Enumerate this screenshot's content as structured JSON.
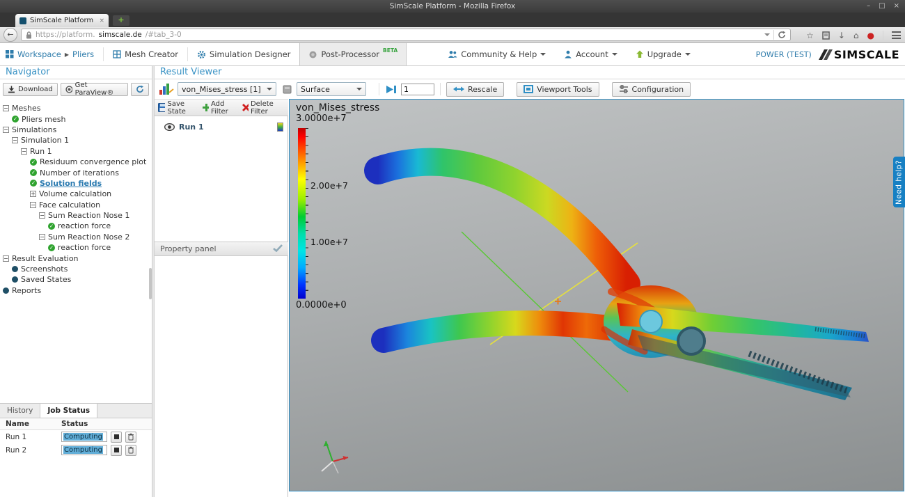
{
  "browser": {
    "window_title": "SimScale Platform - Mozilla Firefox",
    "window_controls": {
      "minimize": "–",
      "maximize": "□",
      "close": "×"
    },
    "tab": {
      "title": "SimScale Platform",
      "close": "×",
      "new_tab": "+"
    },
    "url": {
      "scheme_host": "https://platform.",
      "domain": "simscale.de",
      "path": "/#tab_3-0"
    },
    "icons": {
      "back": "←",
      "star": "☆",
      "downloads": "↓",
      "home": "⌂",
      "extension": "●"
    }
  },
  "app_nav": {
    "workspace": "Workspace",
    "breadcrumb_arrow": "▶",
    "project": "Pliers",
    "mesh_creator": "Mesh Creator",
    "simulation_designer": "Simulation Designer",
    "post_processor": "Post-Processor",
    "beta": "BETA",
    "community": "Community & Help",
    "account": "Account",
    "upgrade": "Upgrade",
    "user": "POWER (TEST)",
    "brand": "SIMSCALE"
  },
  "navigator": {
    "title": "Navigator",
    "buttons": {
      "download": "Download",
      "paraview": "Get ParaView®"
    },
    "tree": [
      {
        "label": "Meshes",
        "icon": "collapse",
        "indent": 0
      },
      {
        "label": "Pliers mesh",
        "icon": "check",
        "indent": 1
      },
      {
        "label": "Simulations",
        "icon": "collapse",
        "indent": 0
      },
      {
        "label": "Simulation 1",
        "icon": "collapse",
        "indent": 1
      },
      {
        "label": "Run 1",
        "icon": "collapse",
        "indent": 2
      },
      {
        "label": "Residuum convergence plot",
        "icon": "check",
        "indent": 3
      },
      {
        "label": "Number of iterations",
        "icon": "check",
        "indent": 3
      },
      {
        "label": "Solution fields",
        "icon": "check",
        "indent": 3,
        "selected": true
      },
      {
        "label": "Volume calculation",
        "icon": "expand",
        "indent": 3
      },
      {
        "label": "Face calculation",
        "icon": "collapse",
        "indent": 3
      },
      {
        "label": "Sum Reaction Nose 1",
        "icon": "collapse",
        "indent": 4
      },
      {
        "label": "reaction force",
        "icon": "check",
        "indent": 5
      },
      {
        "label": "Sum Reaction Nose 2",
        "icon": "collapse",
        "indent": 4
      },
      {
        "label": "reaction force",
        "icon": "check",
        "indent": 5
      },
      {
        "label": "Result Evaluation",
        "icon": "collapse",
        "indent": 0
      },
      {
        "label": "Screenshots",
        "icon": "dot",
        "indent": 1
      },
      {
        "label": "Saved States",
        "icon": "dot",
        "indent": 1
      },
      {
        "label": "Reports",
        "icon": "dot",
        "indent": 0
      }
    ],
    "tabs": {
      "history": "History",
      "job_status": "Job Status"
    },
    "job_table": {
      "col_name": "Name",
      "col_status": "Status",
      "rows": [
        {
          "name": "Run 1",
          "status": "Computing"
        },
        {
          "name": "Run 2",
          "status": "Computing"
        }
      ]
    }
  },
  "result_viewer": {
    "title": "Result Viewer",
    "toolbar": {
      "field_select": "von_Mises_stress [1]",
      "repr_select": "Surface",
      "frame_value": "1",
      "rescale": "Rescale",
      "viewport_tools": "Viewport Tools",
      "configuration": "Configuration"
    },
    "filter_bar": {
      "save_state": "Save State",
      "add_filter": "Add Filter",
      "delete_filter": "Delete Filter"
    },
    "pipeline": {
      "run_label": "Run 1"
    },
    "property_panel_title": "Property panel",
    "need_help": "Need help?"
  },
  "viewport": {
    "field_label": "von_Mises_stress",
    "legend": {
      "max": "3.0000e+7",
      "tick2": "2.00e+7",
      "tick1": "1.00e+7",
      "min": "0.0000e+0"
    }
  }
}
